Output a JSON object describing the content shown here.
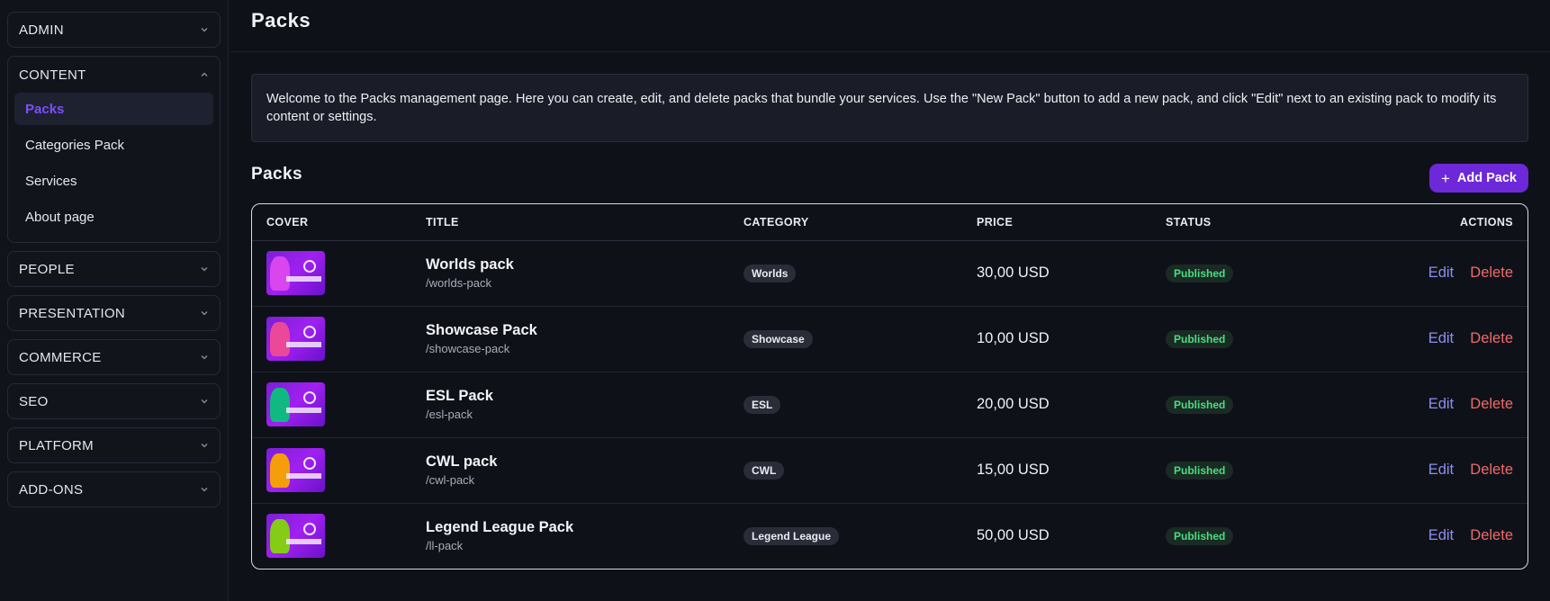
{
  "sidebar": {
    "groups": [
      {
        "label": "ADMIN",
        "open": false
      },
      {
        "label": "CONTENT",
        "open": true,
        "items": [
          {
            "label": "Packs",
            "active": true
          },
          {
            "label": "Categories Pack"
          },
          {
            "label": "Services"
          },
          {
            "label": "About page"
          }
        ]
      },
      {
        "label": "PEOPLE",
        "open": false
      },
      {
        "label": "PRESENTATION",
        "open": false
      },
      {
        "label": "COMMERCE",
        "open": false
      },
      {
        "label": "SEO",
        "open": false
      },
      {
        "label": "PLATFORM",
        "open": false
      },
      {
        "label": "ADD-ONS",
        "open": false
      }
    ]
  },
  "header": {
    "title": "Packs"
  },
  "info": {
    "text": "Welcome to the Packs management page. Here you can create, edit, and delete packs that bundle your services. Use the \"New Pack\" button to add a new pack, and click \"Edit\" next to an existing pack to modify its content or settings."
  },
  "section": {
    "title": "Packs",
    "add_label": "Add Pack"
  },
  "table": {
    "headers": {
      "cover": "COVER",
      "title": "TITLE",
      "category": "CATEGORY",
      "price": "PRICE",
      "status": "STATUS",
      "actions": "ACTIONS"
    },
    "edit_label": "Edit",
    "delete_label": "Delete",
    "rows": [
      {
        "title": "Worlds pack",
        "slug": "/worlds-pack",
        "category": "Worlds",
        "price": "30,00 USD",
        "status": "Published",
        "accent": "#d946ef"
      },
      {
        "title": "Showcase Pack",
        "slug": "/showcase-pack",
        "category": "Showcase",
        "price": "10,00 USD",
        "status": "Published",
        "accent": "#ec4899"
      },
      {
        "title": "ESL Pack",
        "slug": "/esl-pack",
        "category": "ESL",
        "price": "20,00 USD",
        "status": "Published",
        "accent": "#10b981"
      },
      {
        "title": "CWL pack",
        "slug": "/cwl-pack",
        "category": "CWL",
        "price": "15,00 USD",
        "status": "Published",
        "accent": "#f59e0b"
      },
      {
        "title": "Legend League Pack",
        "slug": "/ll-pack",
        "category": "Legend League",
        "price": "50,00 USD",
        "status": "Published",
        "accent": "#84cc16"
      }
    ]
  },
  "colors": {
    "accent": "#6d28d9",
    "active_nav": "#7c4dff",
    "published": "#4ade80",
    "edit": "#8b8ff0",
    "delete": "#f06a6a"
  }
}
